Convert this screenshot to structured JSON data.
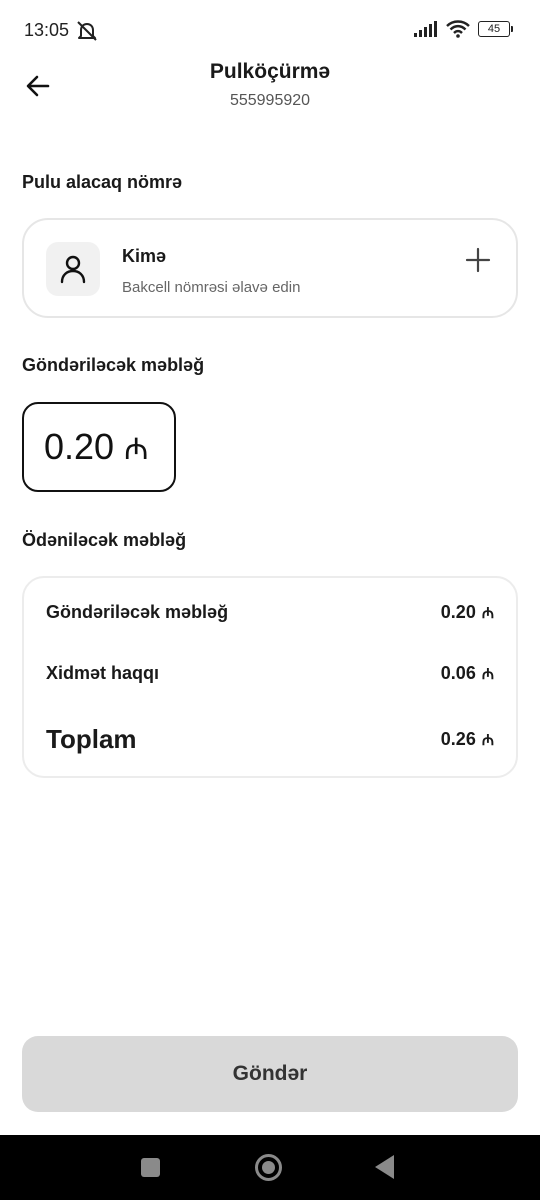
{
  "status_bar": {
    "time": "13:05",
    "battery": "45"
  },
  "header": {
    "title": "Pulköçürmə",
    "subtitle": "555995920"
  },
  "recipient": {
    "section_label": "Pulu alacaq nömrə",
    "title": "Kimə",
    "hint": "Bakcell nömrəsi əlavə edin"
  },
  "amount": {
    "section_label": "Göndəriləcək məbləğ",
    "value": "0.20",
    "currency": "₼"
  },
  "summary": {
    "section_label": "Ödəniləcək məbləğ",
    "rows": [
      {
        "label": "Göndəriləcək məbləğ",
        "value": "0.20",
        "currency": "₼"
      },
      {
        "label": "Xidmət haqqı",
        "value": "0.06",
        "currency": "₼"
      },
      {
        "label": "Toplam",
        "value": "0.26",
        "currency": "₼"
      }
    ]
  },
  "send_button": {
    "label": "Göndər"
  },
  "icons": [
    "dnd-bell-icon",
    "signal-icon",
    "wifi-icon",
    "battery-icon",
    "back-arrow-icon",
    "person-icon",
    "plus-icon",
    "nav-recents-icon",
    "nav-home-icon",
    "nav-back-icon"
  ]
}
